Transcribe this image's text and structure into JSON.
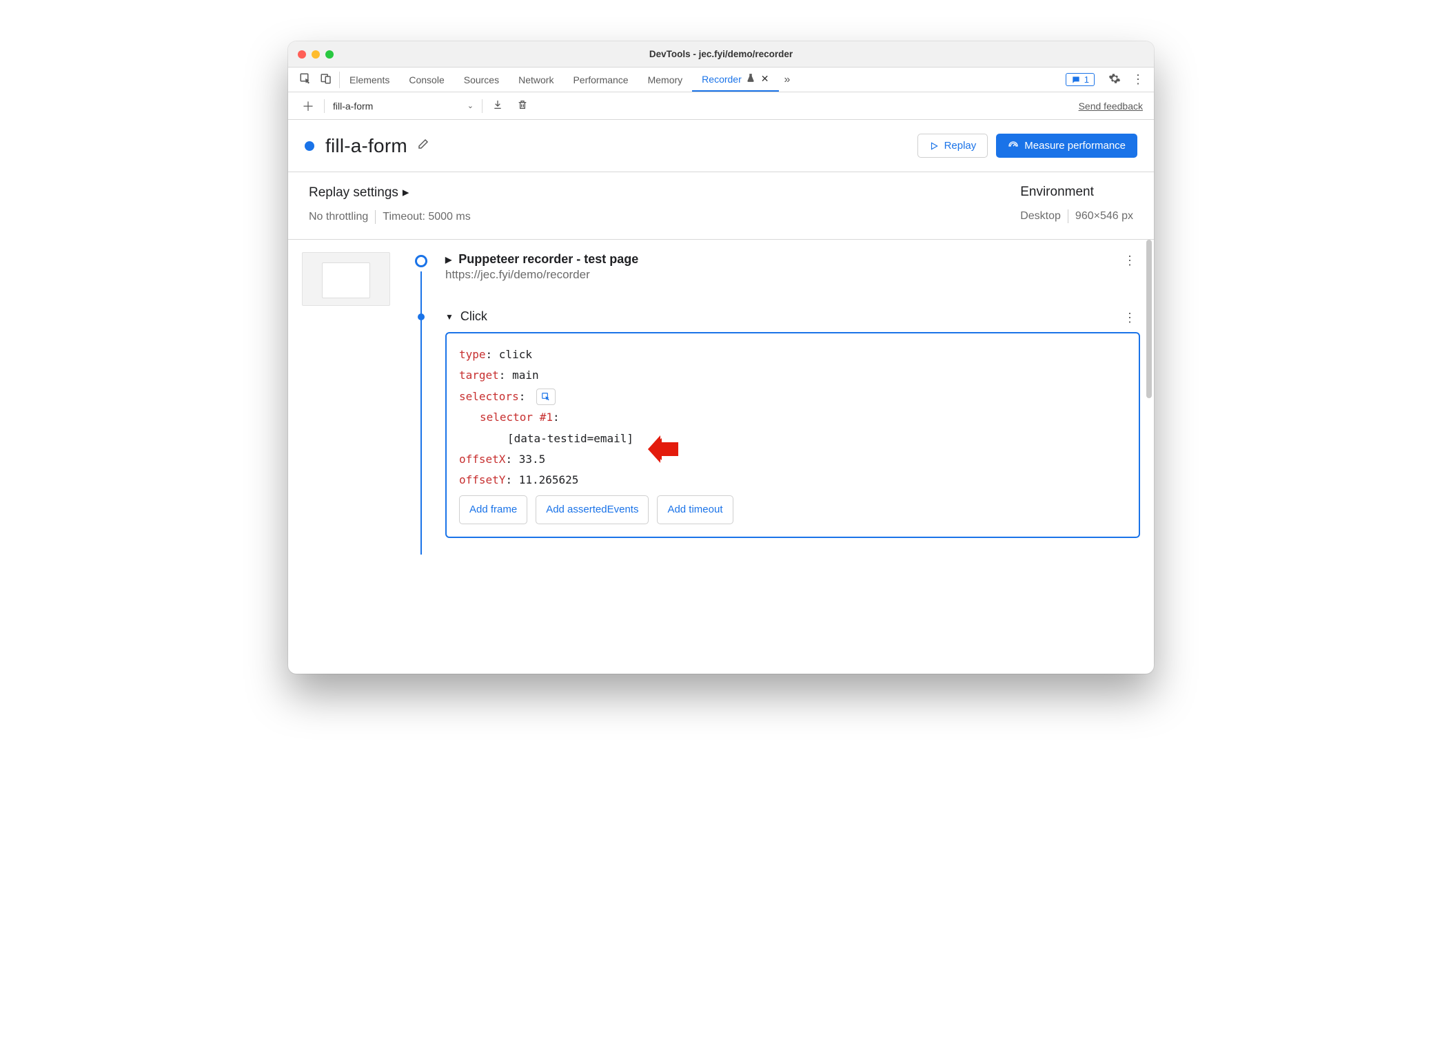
{
  "window": {
    "title": "DevTools - jec.fyi/demo/recorder"
  },
  "tabs": {
    "items": [
      "Elements",
      "Console",
      "Sources",
      "Network",
      "Performance",
      "Memory",
      "Recorder"
    ],
    "activeIndex": 6,
    "badgeCount": "1"
  },
  "toolbar": {
    "recording": "fill-a-form",
    "feedback": "Send feedback"
  },
  "header": {
    "name": "fill-a-form",
    "replay": "Replay",
    "measure": "Measure performance"
  },
  "settings": {
    "left_title": "Replay settings",
    "throttling": "No throttling",
    "timeout": "Timeout: 5000 ms",
    "right_title": "Environment",
    "device": "Desktop",
    "viewport": "960×546 px"
  },
  "steps": {
    "first": {
      "title": "Puppeteer recorder - test page",
      "url": "https://jec.fyi/demo/recorder"
    },
    "click": {
      "label": "Click",
      "type_key": "type",
      "type_val": "click",
      "target_key": "target",
      "target_val": "main",
      "selectors_key": "selectors",
      "sel1_key": "selector #1",
      "sel1_val": "[data-testid=email]",
      "offx_key": "offsetX",
      "offx_val": "33.5",
      "offy_key": "offsetY",
      "offy_val": "11.265625",
      "add_frame": "Add frame",
      "add_asserted": "Add assertedEvents",
      "add_timeout": "Add timeout"
    }
  }
}
